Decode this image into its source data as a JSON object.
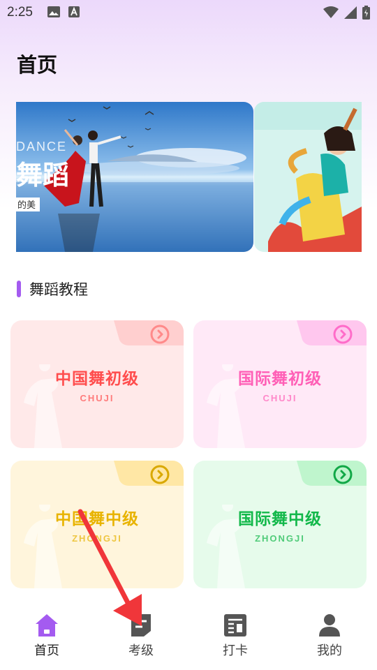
{
  "status_bar": {
    "time": "2:25",
    "icons_left": [
      "image-icon",
      "font-a-icon"
    ],
    "icons_right": [
      "wifi-icon",
      "signal-icon",
      "battery-icon"
    ]
  },
  "page": {
    "title": "首页"
  },
  "banners": [
    {
      "name": "banner-dance-couple",
      "texts": [
        "DANCE",
        "舞蹈",
        "的美"
      ]
    },
    {
      "name": "banner-dancer-illustration"
    }
  ],
  "section": {
    "title": "舞蹈教程",
    "accent_color": "#a45bf0"
  },
  "cards": [
    {
      "title": "中国舞初级",
      "subtitle": "CHUJI",
      "title_color": "#ff4d4d",
      "bg": "#ffe9e9",
      "tab_color": "#ffcfcf",
      "arrow_color": "#ff8a8a"
    },
    {
      "title": "国际舞初级",
      "subtitle": "CHUJI",
      "title_color": "#ff5fb6",
      "bg": "#ffe9f7",
      "tab_color": "#ffc7ee",
      "arrow_color": "#ff6cc9"
    },
    {
      "title": "中国舞中级",
      "subtitle": "ZHONGJI",
      "title_color": "#e8b300",
      "bg": "#fff5dc",
      "tab_color": "#ffe7a5",
      "arrow_color": "#d9a800"
    },
    {
      "title": "国际舞中级",
      "subtitle": "ZHONGJI",
      "title_color": "#12b84a",
      "bg": "#e6fbeb",
      "tab_color": "#bff5cd",
      "arrow_color": "#12a847"
    }
  ],
  "tabbar": {
    "items": [
      {
        "label": "首页",
        "icon": "home-icon",
        "active": true,
        "color": "#a45bf0"
      },
      {
        "label": "考级",
        "icon": "document-icon",
        "active": false,
        "color": "#555555"
      },
      {
        "label": "打卡",
        "icon": "news-icon",
        "active": false,
        "color": "#555555"
      },
      {
        "label": "我的",
        "icon": "person-icon",
        "active": false,
        "color": "#555555"
      }
    ]
  },
  "annotation": {
    "arrow_color": "#f0363a"
  }
}
